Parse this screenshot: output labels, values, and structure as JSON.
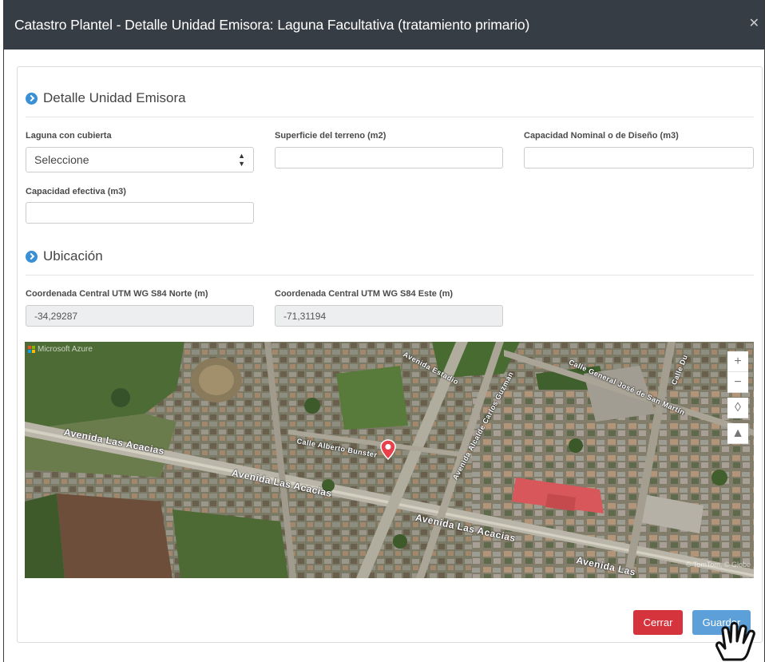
{
  "modal": {
    "title": "Catastro Plantel - Detalle Unidad Emisora: Laguna Facultativa (tratamiento primario)",
    "close_icon": "close-icon"
  },
  "section_detail": {
    "title": "Detalle Unidad Emisora",
    "fields": {
      "laguna_cubierta": {
        "label": "Laguna con cubierta",
        "value": "Seleccione"
      },
      "superficie": {
        "label": "Superficie del terreno (m2)",
        "value": ""
      },
      "capacidad_nominal": {
        "label": "Capacidad Nominal o de Diseño (m3)",
        "value": ""
      },
      "capacidad_efectiva": {
        "label": "Capacidad efectiva (m3)",
        "value": ""
      }
    }
  },
  "section_location": {
    "title": "Ubicación",
    "fields": {
      "norte": {
        "label": "Coordenada Central UTM WG S84 Norte (m)",
        "value": "-34,29287"
      },
      "este": {
        "label": "Coordenada Central UTM WG S84 Este (m)",
        "value": "-71,31194"
      }
    }
  },
  "map": {
    "brand": "Microsoft Azure",
    "attribution": "© TomTom, © Globe",
    "controls": [
      "+",
      "−",
      "◊",
      "▲"
    ],
    "streets": {
      "acacias_1": "Avenida Las Acacias",
      "acacias_2": "Avenida Las Acacias",
      "acacias_3": "Avenida Las Acacias",
      "acacias_4": "Avenida Las",
      "carlos": "Avenida Alcalde Carlos Guzmán",
      "estadio": "Avenida Estadio",
      "sanmartin": "Calle General José de San Martín",
      "bunster": "Calle Alberto Bunster",
      "du": "Calle Du"
    },
    "colors": {
      "pin": "#e8414b"
    }
  },
  "footer": {
    "close_label": "Cerrar",
    "save_label": "Guardar"
  }
}
